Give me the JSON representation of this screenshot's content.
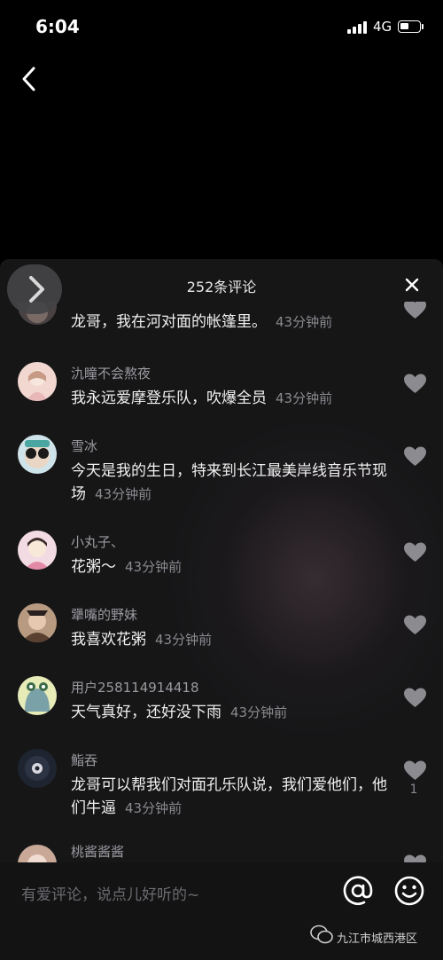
{
  "status_bar": {
    "time": "6:04",
    "network": "4G"
  },
  "panel": {
    "title": "252条评论"
  },
  "comments": [
    {
      "username": "",
      "text": "龙哥，我在河对面的帐篷里。",
      "time": "43分钟前",
      "likes": ""
    },
    {
      "username": "氿瞳不会熬夜",
      "text": "我永远爱摩登乐队，吹爆全员",
      "time": "43分钟前",
      "likes": ""
    },
    {
      "username": "雪冰",
      "text": "今天是我的生日，特来到长江最美岸线音乐节现场",
      "time": "43分钟前",
      "likes": ""
    },
    {
      "username": "小丸子、",
      "text": "花粥～",
      "time": "43分钟前",
      "likes": ""
    },
    {
      "username": "犟嘴的野妹",
      "text": "我喜欢花粥",
      "time": "43分钟前",
      "likes": ""
    },
    {
      "username": "用户258114914418",
      "text": "天气真好，还好没下雨",
      "time": "43分钟前",
      "likes": ""
    },
    {
      "username": "鮨吞",
      "text": "龙哥可以帮我们对面孔乐队说，我们爱他们，他们牛逼",
      "time": "43分钟前",
      "likes": "1"
    },
    {
      "username": "桃酱酱酱",
      "text": "",
      "time": "",
      "likes": ""
    }
  ],
  "input": {
    "placeholder": "有爱评论，说点儿好听的~"
  },
  "watermark": {
    "text": "九江市城西港区"
  },
  "icons": {
    "back": "back-arrow-icon",
    "close": "close-icon",
    "like": "heart-icon",
    "at": "at-sign-icon",
    "emoji": "smiley-icon"
  },
  "colors": {
    "background": "#000000",
    "panel": "#161617",
    "muted": "#8a8a90"
  }
}
